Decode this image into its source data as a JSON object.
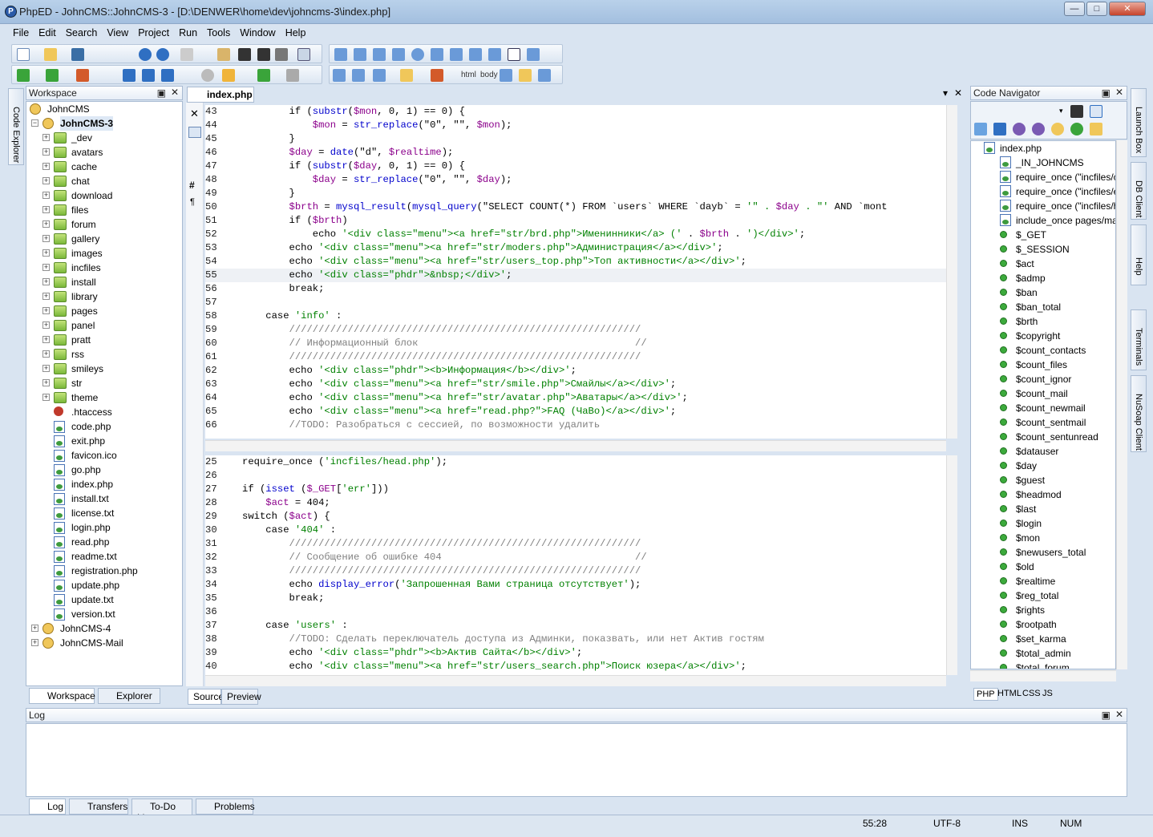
{
  "window": {
    "title": "PhpED - JohnCMS::JohnCMS-3 - [D:\\DENWER\\home\\dev\\johncms-3\\index.php]"
  },
  "menu": [
    "File",
    "Edit",
    "Search",
    "View",
    "Project",
    "Run",
    "Tools",
    "Window",
    "Help"
  ],
  "workspace": {
    "title": "Workspace",
    "root": "JohnCMS",
    "project": "JohnCMS-3",
    "folders": [
      "_dev",
      "avatars",
      "cache",
      "chat",
      "download",
      "files",
      "forum",
      "gallery",
      "images",
      "incfiles",
      "install",
      "library",
      "pages",
      "panel",
      "pratt",
      "rss",
      "smileys",
      "str",
      "theme"
    ],
    "files": [
      ".htaccess",
      "code.php",
      "exit.php",
      "favicon.ico",
      "go.php",
      "index.php",
      "install.txt",
      "license.txt",
      "login.php",
      "read.php",
      "readme.txt",
      "registration.php",
      "update.php",
      "update.txt",
      "version.txt"
    ],
    "other_projects": [
      "JohnCMS-4",
      "JohnCMS-Mail"
    ],
    "tabs": [
      "Workspace",
      "Explorer"
    ],
    "side_tab": "Code Explorer"
  },
  "editor": {
    "tab": "index.php",
    "bottom_tabs": [
      "Source",
      "Preview"
    ],
    "top_lines": [
      {
        "n": "43",
        "t": "        if (substr($mon, 0, 1) == 0) {"
      },
      {
        "n": "44",
        "t": "            $mon = str_replace(\"0\", \"\", $mon);"
      },
      {
        "n": "45",
        "t": "        }"
      },
      {
        "n": "46",
        "t": "        $day = date(\"d\", $realtime);"
      },
      {
        "n": "47",
        "t": "        if (substr($day, 0, 1) == 0) {"
      },
      {
        "n": "48",
        "t": "            $day = str_replace(\"0\", \"\", $day);"
      },
      {
        "n": "49",
        "t": "        }"
      },
      {
        "n": "50",
        "t": "        $brth = mysql_result(mysql_query(\"SELECT COUNT(*) FROM `users` WHERE `dayb` = '\" . $day . \"' AND `mont"
      },
      {
        "n": "51",
        "t": "        if ($brth)"
      },
      {
        "n": "52",
        "t": "            echo '<div class=\"menu\"><a href=\"str/brd.php\">Именинники</a> (' . $brth . ')</div>';"
      },
      {
        "n": "53",
        "t": "        echo '<div class=\"menu\"><a href=\"str/moders.php\">Администрация</a></div>';"
      },
      {
        "n": "54",
        "t": "        echo '<div class=\"menu\"><a href=\"str/users_top.php\">Топ активности</a></div>';"
      },
      {
        "n": "55",
        "t": "        echo '<div class=\"phdr\">&nbsp;</div>';"
      },
      {
        "n": "56",
        "t": "        break;"
      },
      {
        "n": "57",
        "t": ""
      },
      {
        "n": "58",
        "t": "    case 'info' :"
      },
      {
        "n": "59",
        "t": "        ////////////////////////////////////////////////////////////"
      },
      {
        "n": "60",
        "t": "        // Информационный блок                                     //"
      },
      {
        "n": "61",
        "t": "        ////////////////////////////////////////////////////////////"
      },
      {
        "n": "62",
        "t": "        echo '<div class=\"phdr\"><b>Информация</b></div>';"
      },
      {
        "n": "63",
        "t": "        echo '<div class=\"menu\"><a href=\"str/smile.php\">Смайлы</a></div>';"
      },
      {
        "n": "64",
        "t": "        echo '<div class=\"menu\"><a href=\"str/avatar.php\">Аватары</a></div>';"
      },
      {
        "n": "65",
        "t": "        echo '<div class=\"menu\"><a href=\"read.php?\">FAQ (ЧаВо)</a></div>';"
      },
      {
        "n": "66",
        "t": "        //TODO: Разобраться с сессией, по возможности удалить"
      }
    ],
    "bottom_lines": [
      {
        "n": "25",
        "t": "require_once ('incfiles/head.php');"
      },
      {
        "n": "26",
        "t": ""
      },
      {
        "n": "27",
        "t": "if (isset ($_GET['err']))"
      },
      {
        "n": "28",
        "t": "    $act = 404;"
      },
      {
        "n": "29",
        "t": "switch ($act) {"
      },
      {
        "n": "30",
        "t": "    case '404' :"
      },
      {
        "n": "31",
        "t": "        ////////////////////////////////////////////////////////////"
      },
      {
        "n": "32",
        "t": "        // Сообщение об ошибке 404                                 //"
      },
      {
        "n": "33",
        "t": "        ////////////////////////////////////////////////////////////"
      },
      {
        "n": "34",
        "t": "        echo display_error('Запрошенная Вами страница отсутствует');"
      },
      {
        "n": "35",
        "t": "        break;"
      },
      {
        "n": "36",
        "t": ""
      },
      {
        "n": "37",
        "t": "    case 'users' :"
      },
      {
        "n": "38",
        "t": "        //TODO: Сделать переключатель доступа из Админки, показвать, или нет Актив гостям"
      },
      {
        "n": "39",
        "t": "        echo '<div class=\"phdr\"><b>Актив Сайта</b></div>';"
      },
      {
        "n": "40",
        "t": "        echo '<div class=\"menu\"><a href=\"str/users_search.php\">Поиск юзера</a></div>';"
      }
    ]
  },
  "navigator": {
    "title": "Code Navigator",
    "file": "index.php",
    "items": [
      "_IN_JOHNCMS",
      "require_once (\"incfiles/co",
      "require_once (\"incfiles/en",
      "require_once (\"incfiles/he",
      "include_once pages/main"
    ],
    "vars": [
      "$_GET",
      "$_SESSION",
      "$act",
      "$admp",
      "$ban",
      "$ban_total",
      "$brth",
      "$copyright",
      "$count_contacts",
      "$count_files",
      "$count_ignor",
      "$count_mail",
      "$count_newmail",
      "$count_sentmail",
      "$count_sentunread",
      "$datauser",
      "$day",
      "$guest",
      "$headmod",
      "$last",
      "$login",
      "$mon",
      "$newusers_total",
      "$old",
      "$realtime",
      "$reg_total",
      "$rights",
      "$rootpath",
      "$set_karma",
      "$total_admin",
      "$total_forum"
    ],
    "tabs": [
      "PHP",
      "HTML",
      "CSS",
      "JS"
    ]
  },
  "right_tabs": [
    "Launch Box",
    "DB Client",
    "Help",
    "Terminals",
    "NuSoap Client"
  ],
  "log": {
    "title": "Log",
    "tabs": [
      "Log",
      "Transfers",
      "To-Do List",
      "Problems"
    ]
  },
  "status": {
    "position": "55:28",
    "encoding": "UTF-8",
    "mode": "INS",
    "num": "NUM"
  },
  "colors": {
    "accent": "#3a6ea5",
    "keyword": "#000080",
    "string": "#008000",
    "comment": "#808080"
  }
}
